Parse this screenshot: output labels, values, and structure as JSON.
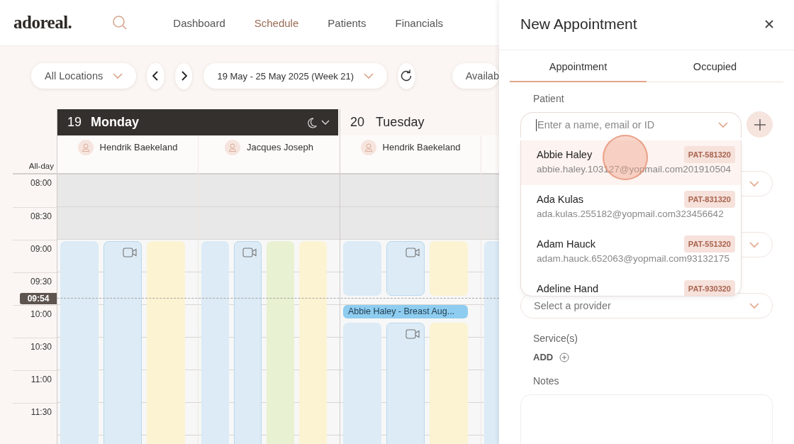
{
  "app": {
    "logo": "adoreal.",
    "nav": [
      {
        "label": "Dashboard",
        "selected": false
      },
      {
        "label": "Schedule",
        "selected": true
      },
      {
        "label": "Patients",
        "selected": false
      },
      {
        "label": "Financials",
        "selected": false
      }
    ]
  },
  "toolbar": {
    "location": "All Locations",
    "date_range": "19 May - 25 May 2025 (Week 21)",
    "availability": "Availab"
  },
  "calendar": {
    "all_day_label": "All-day",
    "times": [
      "08:00",
      "08:30",
      "09:00",
      "09:30",
      "10:00",
      "10:30",
      "11:00",
      "11:30"
    ],
    "now": "09:54",
    "days": [
      {
        "date": "19",
        "name": "Monday",
        "selected": true,
        "providers": [
          {
            "name": "Hendrik Baekeland",
            "slots": [
              {
                "color": "#dcebf6",
                "video": false
              },
              {
                "color": "#dcebf6",
                "video": true
              },
              {
                "color": "#fbf3d2",
                "video": false
              }
            ]
          },
          {
            "name": "Jacques Joseph",
            "slots": [
              {
                "color": "#dcebf6",
                "video": false
              },
              {
                "color": "#dcebf6",
                "video": true
              },
              {
                "color": "#e8f1d2",
                "video": false
              },
              {
                "color": "#fbf3d2",
                "video": false
              }
            ]
          }
        ]
      },
      {
        "date": "20",
        "name": "Tuesday",
        "selected": false,
        "providers": [
          {
            "name": "Hendrik Baekeland",
            "event": "Abbie Haley - Breast Aug...",
            "slots": [
              {
                "color": "#dcebf6",
                "video": false
              },
              {
                "color": "#dcebf6",
                "video": true
              },
              {
                "color": "#fbf3d2",
                "video": false
              }
            ]
          },
          {
            "slots": [
              {
                "color": "#dcebf6",
                "video": false
              }
            ]
          }
        ]
      }
    ]
  },
  "panel": {
    "title": "New Appointment",
    "tabs": [
      {
        "label": "Appointment",
        "selected": true
      },
      {
        "label": "Occupied",
        "selected": false
      }
    ],
    "fields": [
      {
        "kind": "combobox",
        "label": "Patient",
        "placeholder": "Enter a name, email or ID"
      },
      {
        "kind": "select"
      },
      {
        "kind": "select"
      },
      {
        "kind": "select",
        "placeholder": "Select a provider"
      },
      {
        "kind": "services",
        "label": "Service(s)",
        "action": "ADD"
      },
      {
        "kind": "textarea",
        "label": "Notes"
      }
    ],
    "patient_options": [
      {
        "name": "Abbie Haley",
        "email": "abbie.haley.103127@yopmail.com201910504",
        "id": "PAT-581320",
        "selected": true
      },
      {
        "name": "Ada Kulas",
        "email": "ada.kulas.255182@yopmail.com323456642",
        "id": "PAT-831320",
        "selected": false
      },
      {
        "name": "Adam Hauck",
        "email": "adam.hauck.652063@yopmail.com93132175",
        "id": "PAT-551320",
        "selected": false
      },
      {
        "name": "Adeline Hand",
        "id": "PAT-930320",
        "selected": false
      }
    ]
  }
}
